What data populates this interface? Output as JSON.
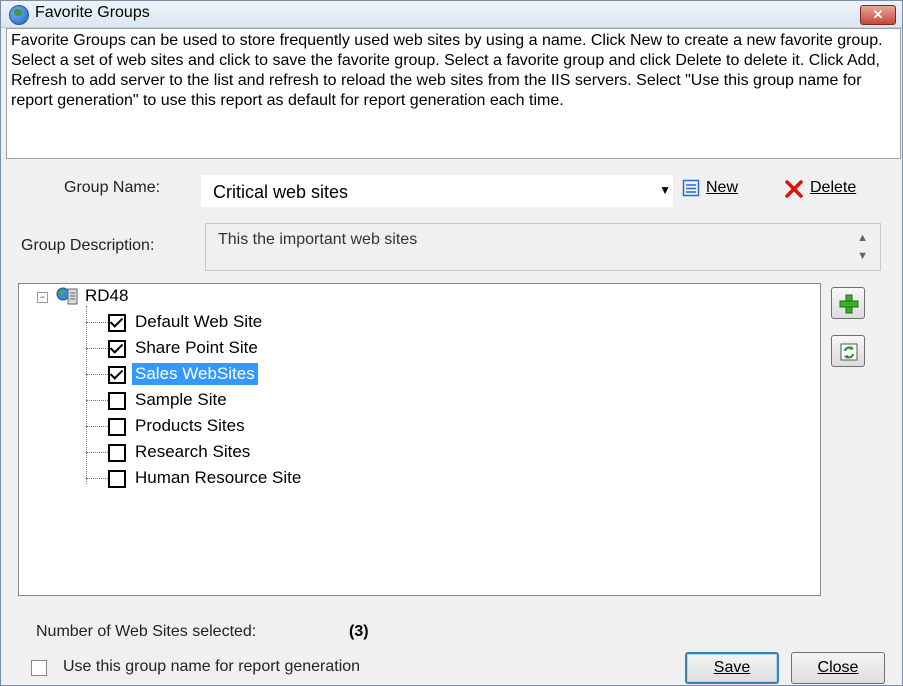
{
  "window": {
    "title": "Favorite Groups",
    "close_label": "✕"
  },
  "description": "Favorite Groups can be used to store frequently used web sites by using a name. Click New to create a new favorite group. Select a set of web sites and click to save the favorite group. Select a favorite group and click Delete to delete it. Click Add, Refresh to add server to the list and refresh to reload the web sites from the IIS servers. Select \"Use this group name for report generation\" to use this report as default for report generation each time.",
  "group_name": {
    "label": "Group Name:",
    "value": "Critical web sites",
    "new_label": "New",
    "delete_label": "Delete"
  },
  "group_description": {
    "label": "Group Description:",
    "value": "This the important web sites"
  },
  "tree": {
    "root": "RD48",
    "items": [
      {
        "label": "Default Web Site",
        "checked": true,
        "selected": false
      },
      {
        "label": "Share Point Site",
        "checked": true,
        "selected": false
      },
      {
        "label": "Sales WebSites",
        "checked": true,
        "selected": true
      },
      {
        "label": "Sample Site",
        "checked": false,
        "selected": false
      },
      {
        "label": "Products Sites",
        "checked": false,
        "selected": false
      },
      {
        "label": "Research Sites",
        "checked": false,
        "selected": false
      },
      {
        "label": "Human Resource Site",
        "checked": false,
        "selected": false
      }
    ]
  },
  "side_buttons": {
    "add_icon": "plus-icon",
    "refresh_icon": "refresh-icon"
  },
  "footer": {
    "count_label": "Number of Web Sites selected:",
    "count_value": "(3)",
    "report_checkbox_label": "Use this group name for report generation",
    "report_checkbox_checked": false,
    "save_label": "Save",
    "close_label": "Close"
  }
}
